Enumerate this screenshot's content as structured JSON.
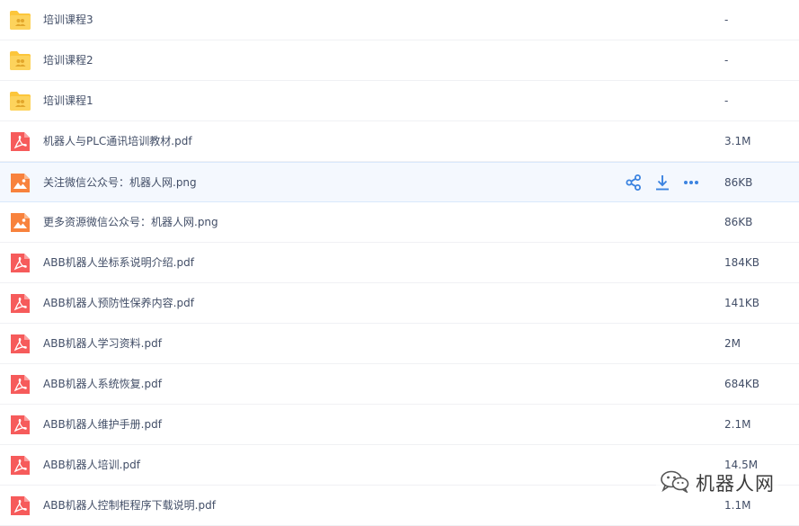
{
  "files": [
    {
      "type": "folder",
      "name": "培训课程3",
      "size": "-"
    },
    {
      "type": "folder",
      "name": "培训课程2",
      "size": "-"
    },
    {
      "type": "folder",
      "name": "培训课程1",
      "size": "-"
    },
    {
      "type": "pdf",
      "name": "机器人与PLC通讯培训教材.pdf",
      "size": "3.1M"
    },
    {
      "type": "image",
      "name": "关注微信公众号：机器人网.png",
      "size": "86KB",
      "hover": true
    },
    {
      "type": "image",
      "name": "更多资源微信公众号：机器人网.png",
      "size": "86KB"
    },
    {
      "type": "pdf",
      "name": "ABB机器人坐标系说明介绍.pdf",
      "size": "184KB"
    },
    {
      "type": "pdf",
      "name": "ABB机器人预防性保养内容.pdf",
      "size": "141KB"
    },
    {
      "type": "pdf",
      "name": "ABB机器人学习资料.pdf",
      "size": "2M"
    },
    {
      "type": "pdf",
      "name": "ABB机器人系统恢复.pdf",
      "size": "684KB"
    },
    {
      "type": "pdf",
      "name": "ABB机器人维护手册.pdf",
      "size": "2.1M"
    },
    {
      "type": "pdf",
      "name": "ABB机器人培训.pdf",
      "size": "14.5M"
    },
    {
      "type": "pdf",
      "name": "ABB机器人控制柜程序下载说明.pdf",
      "size": "1.1M"
    }
  ],
  "row_actions": [
    "share-icon",
    "download-icon",
    "more-icon"
  ],
  "watermark": {
    "text": "机器人网",
    "icon": "wechat-icon"
  },
  "colors": {
    "folder": "#fcc63b",
    "pdf": "#f65b5b",
    "image": "#f8823d",
    "action": "#3b83e0",
    "text": "#424e67"
  }
}
